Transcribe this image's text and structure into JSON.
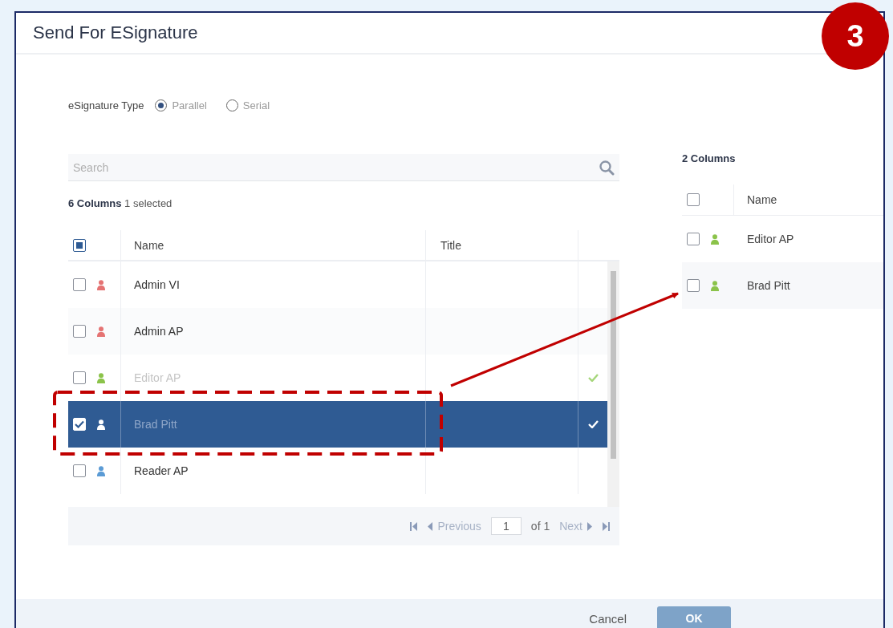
{
  "dialog": {
    "title": "Send For ESignature"
  },
  "signature_type": {
    "label": "eSignature Type",
    "options": [
      {
        "label": "Parallel",
        "selected": true
      },
      {
        "label": "Serial",
        "selected": false
      }
    ]
  },
  "available": {
    "search": {
      "placeholder": "Search"
    },
    "summary": "**6 Columns** 1 selected",
    "select_all": {
      "partial": true
    },
    "columns": [
      "Name",
      "Title"
    ],
    "rows": [
      {
        "name": "Admin VI",
        "checked": false,
        "selected": false,
        "disabled": false,
        "added": false,
        "color": "#e57373"
      },
      {
        "name": "Admin AP",
        "checked": false,
        "selected": false,
        "disabled": false,
        "added": false,
        "color": "#e57373"
      },
      {
        "name": "Editor AP",
        "checked": false,
        "selected": false,
        "disabled": true,
        "added": true,
        "color": "#8bc34a"
      },
      {
        "name": "Brad Pitt",
        "checked": true,
        "selected": true,
        "disabled": false,
        "added": true
      },
      {
        "name": "Reader AP",
        "checked": false,
        "selected": false,
        "disabled": false,
        "added": false,
        "color": "#5b9bd5"
      }
    ],
    "pager": {
      "previous": "Previous",
      "page": "1",
      "of": "of 1",
      "next": "Next"
    }
  },
  "chosen": {
    "summary": "2 Columns",
    "select_all": {
      "checked": false
    },
    "columns": [
      "Name"
    ],
    "rows": [
      {
        "name": "Editor AP",
        "checked": false,
        "color": "#8bc34a"
      },
      {
        "name": "Brad Pitt",
        "checked": false,
        "color": "#8bc34a"
      }
    ]
  },
  "buttons": [
    {
      "label": "Cancel",
      "kind": "link"
    },
    {
      "label": "OK",
      "kind": "primary"
    }
  ],
  "annotation": {
    "step": "3"
  }
}
